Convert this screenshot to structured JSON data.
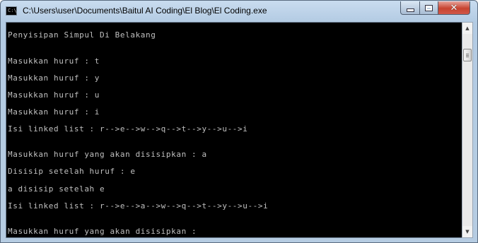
{
  "window": {
    "title": "C:\\Users\\user\\Documents\\Baitul AI Coding\\El Blog\\El Coding.exe",
    "icon": "console-app-icon",
    "icon_text": "C:\\"
  },
  "controls": {
    "minimize_icon": "minimize-icon",
    "maximize_icon": "maximize-icon",
    "close_icon": "close-icon",
    "close_glyph": "✕"
  },
  "console": {
    "lines": [
      "Penyisipan Simpul Di Belakang",
      "Masukkan huruf : t",
      "Masukkan huruf : y",
      "Masukkan huruf : u",
      "Masukkan huruf : i",
      "Isi linked list : r-->e-->w-->q-->t-->y-->u-->i",
      "Masukkan huruf yang akan disisipkan : a",
      "Disisip setelah huruf : e",
      "a disisip setelah e",
      "Isi linked list : r-->e-->a-->w-->q-->t-->y-->u-->i",
      "Masukkan huruf yang akan disisipkan :"
    ]
  },
  "scrollbar": {
    "up_glyph": "▲",
    "down_glyph": "▼"
  }
}
